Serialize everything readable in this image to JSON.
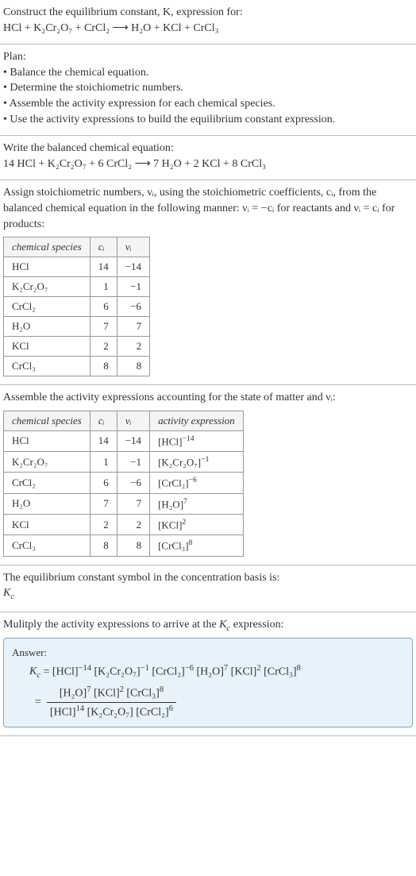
{
  "chart_data": [
    {
      "type": "table",
      "title": "Stoichiometric numbers",
      "columns": [
        "chemical species",
        "c_i",
        "ν_i"
      ],
      "rows": [
        [
          "HCl",
          14,
          -14
        ],
        [
          "K2Cr2O7",
          1,
          -1
        ],
        [
          "CrCl2",
          6,
          -6
        ],
        [
          "H2O",
          7,
          7
        ],
        [
          "KCl",
          2,
          2
        ],
        [
          "CrCl3",
          8,
          8
        ]
      ]
    },
    {
      "type": "table",
      "title": "Activity expressions",
      "columns": [
        "chemical species",
        "c_i",
        "ν_i",
        "activity expression"
      ],
      "rows": [
        [
          "HCl",
          14,
          -14,
          "[HCl]^-14"
        ],
        [
          "K2Cr2O7",
          1,
          -1,
          "[K2Cr2O7]^-1"
        ],
        [
          "CrCl2",
          6,
          -6,
          "[CrCl2]^-6"
        ],
        [
          "H2O",
          7,
          7,
          "[H2O]^7"
        ],
        [
          "KCl",
          2,
          2,
          "[KCl]^2"
        ],
        [
          "CrCl3",
          8,
          8,
          "[CrCl3]^8"
        ]
      ]
    }
  ],
  "s1": {
    "line1": "Construct the equilibrium constant, K, expression for:",
    "eq": "HCl + K₂Cr₂O₇ + CrCl₂ ⟶ H₂O + KCl + CrCl₃"
  },
  "s2": {
    "heading": "Plan:",
    "b1": "• Balance the chemical equation.",
    "b2": "• Determine the stoichiometric numbers.",
    "b3": "• Assemble the activity expression for each chemical species.",
    "b4": "• Use the activity expressions to build the equilibrium constant expression."
  },
  "s3": {
    "line1": "Write the balanced chemical equation:",
    "eq": "14 HCl + K₂Cr₂O₇ + 6 CrCl₂ ⟶ 7 H₂O + 2 KCl + 8 CrCl₃"
  },
  "s4": {
    "intro": "Assign stoichiometric numbers, νᵢ, using the stoichiometric coefficients, cᵢ, from the balanced chemical equation in the following manner: νᵢ = −cᵢ for reactants and νᵢ = cᵢ for products:",
    "h1": "chemical species",
    "h2": "cᵢ",
    "h3": "νᵢ",
    "r": [
      {
        "sp": "HCl",
        "c": "14",
        "v": "−14"
      },
      {
        "sp": "K₂Cr₂O₇",
        "c": "1",
        "v": "−1"
      },
      {
        "sp": "CrCl₂",
        "c": "6",
        "v": "−6"
      },
      {
        "sp": "H₂O",
        "c": "7",
        "v": "7"
      },
      {
        "sp": "KCl",
        "c": "2",
        "v": "2"
      },
      {
        "sp": "CrCl₃",
        "c": "8",
        "v": "8"
      }
    ]
  },
  "s5": {
    "intro": "Assemble the activity expressions accounting for the state of matter and νᵢ:",
    "h1": "chemical species",
    "h2": "cᵢ",
    "h3": "νᵢ",
    "h4": "activity expression",
    "r": [
      {
        "sp": "HCl",
        "c": "14",
        "v": "−14",
        "a_base": "[HCl]",
        "a_exp": "−14"
      },
      {
        "sp": "K₂Cr₂O₇",
        "c": "1",
        "v": "−1",
        "a_base": "[K₂Cr₂O₇]",
        "a_exp": "−1"
      },
      {
        "sp": "CrCl₂",
        "c": "6",
        "v": "−6",
        "a_base": "[CrCl₂]",
        "a_exp": "−6"
      },
      {
        "sp": "H₂O",
        "c": "7",
        "v": "7",
        "a_base": "[H₂O]",
        "a_exp": "7"
      },
      {
        "sp": "KCl",
        "c": "2",
        "v": "2",
        "a_base": "[KCl]",
        "a_exp": "2"
      },
      {
        "sp": "CrCl₃",
        "c": "8",
        "v": "8",
        "a_base": "[CrCl₃]",
        "a_exp": "8"
      }
    ]
  },
  "s6": {
    "line1": "The equilibrium constant symbol in the concentration basis is:",
    "sym": "K_c"
  },
  "s7": {
    "line1": "Mulitply the activity expressions to arrive at the K_c expression:",
    "answer_label": "Answer:",
    "kc": "K_c",
    "eq_sign": " = ",
    "t1b": "[HCl]",
    "t1e": "−14",
    "t2b": "[K₂Cr₂O₇]",
    "t2e": "−1",
    "t3b": "[CrCl₂]",
    "t3e": "−6",
    "t4b": "[H₂O]",
    "t4e": "7",
    "t5b": "[KCl]",
    "t5e": "2",
    "t6b": "[CrCl₃]",
    "t6e": "8",
    "n1b": "[H₂O]",
    "n1e": "7",
    "n2b": "[KCl]",
    "n2e": "2",
    "n3b": "[CrCl₃]",
    "n3e": "8",
    "d1b": "[HCl]",
    "d1e": "14",
    "d2b": "[K₂Cr₂O₇]",
    "d3b": "[CrCl₂]",
    "d3e": "6"
  }
}
